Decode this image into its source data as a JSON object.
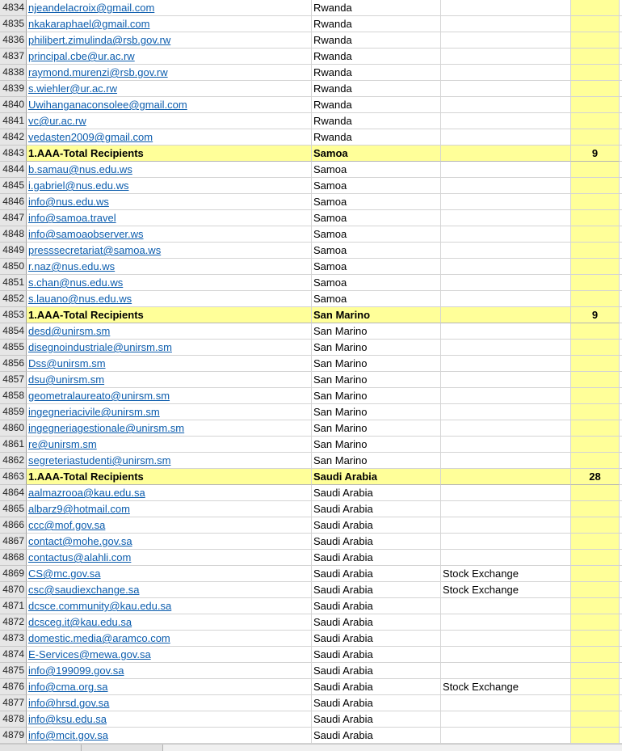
{
  "rows": [
    {
      "num": "4834",
      "email": "njeandelacroix@gmail.com",
      "country": "Rwanda",
      "category": "",
      "count": "",
      "total": false
    },
    {
      "num": "4835",
      "email": "nkakaraphael@gmail.com",
      "country": "Rwanda",
      "category": "",
      "count": "",
      "total": false
    },
    {
      "num": "4836",
      "email": "philibert.zimulinda@rsb.gov.rw",
      "country": "Rwanda",
      "category": "",
      "count": "",
      "total": false
    },
    {
      "num": "4837",
      "email": "principal.cbe@ur.ac.rw",
      "country": "Rwanda",
      "category": "",
      "count": "",
      "total": false
    },
    {
      "num": "4838",
      "email": "raymond.murenzi@rsb.gov.rw",
      "country": "Rwanda",
      "category": "",
      "count": "",
      "total": false
    },
    {
      "num": "4839",
      "email": "s.wiehler@ur.ac.rw",
      "country": "Rwanda",
      "category": "",
      "count": "",
      "total": false
    },
    {
      "num": "4840",
      "email": "Uwihanganaconsolee@gmail.com",
      "country": "Rwanda",
      "category": "",
      "count": "",
      "total": false
    },
    {
      "num": "4841",
      "email": "vc@ur.ac.rw",
      "country": "Rwanda",
      "category": "",
      "count": "",
      "total": false
    },
    {
      "num": "4842",
      "email": "vedasten2009@gmail.com",
      "country": "Rwanda",
      "category": "",
      "count": "",
      "total": false
    },
    {
      "num": "4843",
      "email": "1.AAA-Total Recipients",
      "country": "Samoa",
      "category": "",
      "count": "9",
      "total": true
    },
    {
      "num": "4844",
      "email": "b.samau@nus.edu.ws",
      "country": "Samoa",
      "category": "",
      "count": "",
      "total": false
    },
    {
      "num": "4845",
      "email": "i.gabriel@nus.edu.ws",
      "country": "Samoa",
      "category": "",
      "count": "",
      "total": false
    },
    {
      "num": "4846",
      "email": "info@nus.edu.ws",
      "country": "Samoa",
      "category": "",
      "count": "",
      "total": false
    },
    {
      "num": "4847",
      "email": "info@samoa.travel",
      "country": "Samoa",
      "category": "",
      "count": "",
      "total": false
    },
    {
      "num": "4848",
      "email": "info@samoaobserver.ws",
      "country": "Samoa",
      "category": "",
      "count": "",
      "total": false
    },
    {
      "num": "4849",
      "email": "presssecretariat@samoa.ws",
      "country": "Samoa",
      "category": "",
      "count": "",
      "total": false
    },
    {
      "num": "4850",
      "email": "r.naz@nus.edu.ws",
      "country": "Samoa",
      "category": "",
      "count": "",
      "total": false
    },
    {
      "num": "4851",
      "email": "s.chan@nus.edu.ws",
      "country": "Samoa",
      "category": "",
      "count": "",
      "total": false
    },
    {
      "num": "4852",
      "email": "s.lauano@nus.edu.ws",
      "country": "Samoa",
      "category": "",
      "count": "",
      "total": false
    },
    {
      "num": "4853",
      "email": "1.AAA-Total Recipients",
      "country": "San Marino",
      "category": "",
      "count": "9",
      "total": true
    },
    {
      "num": "4854",
      "email": "desd@unirsm.sm",
      "country": "San Marino",
      "category": "",
      "count": "",
      "total": false
    },
    {
      "num": "4855",
      "email": "disegnoindustriale@unirsm.sm",
      "country": "San Marino",
      "category": "",
      "count": "",
      "total": false
    },
    {
      "num": "4856",
      "email": "Dss@unirsm.sm",
      "country": "San Marino",
      "category": "",
      "count": "",
      "total": false
    },
    {
      "num": "4857",
      "email": "dsu@unirsm.sm",
      "country": "San Marino",
      "category": "",
      "count": "",
      "total": false
    },
    {
      "num": "4858",
      "email": "geometralaureato@unirsm.sm",
      "country": "San Marino",
      "category": "",
      "count": "",
      "total": false
    },
    {
      "num": "4859",
      "email": "ingegneriacivile@unirsm.sm",
      "country": "San Marino",
      "category": "",
      "count": "",
      "total": false
    },
    {
      "num": "4860",
      "email": "ingegneriagestionale@unirsm.sm",
      "country": "San Marino",
      "category": "",
      "count": "",
      "total": false
    },
    {
      "num": "4861",
      "email": "re@unirsm.sm",
      "country": "San Marino",
      "category": "",
      "count": "",
      "total": false
    },
    {
      "num": "4862",
      "email": "segreteriastudenti@unirsm.sm",
      "country": "San Marino",
      "category": "",
      "count": "",
      "total": false
    },
    {
      "num": "4863",
      "email": "1.AAA-Total Recipients",
      "country": "Saudi Arabia",
      "category": "",
      "count": "28",
      "total": true
    },
    {
      "num": "4864",
      "email": "aalmazrooa@kau.edu.sa",
      "country": "Saudi Arabia",
      "category": "",
      "count": "",
      "total": false
    },
    {
      "num": "4865",
      "email": "albarz9@hotmail.com",
      "country": "Saudi Arabia",
      "category": "",
      "count": "",
      "total": false
    },
    {
      "num": "4866",
      "email": "ccc@mof.gov.sa",
      "country": "Saudi Arabia",
      "category": "",
      "count": "",
      "total": false
    },
    {
      "num": "4867",
      "email": "contact@mohe.gov.sa",
      "country": "Saudi Arabia",
      "category": "",
      "count": "",
      "total": false
    },
    {
      "num": "4868",
      "email": "contactus@alahli.com",
      "country": "Saudi Arabia",
      "category": "",
      "count": "",
      "total": false
    },
    {
      "num": "4869",
      "email": "CS@mc.gov.sa",
      "country": "Saudi Arabia",
      "category": "Stock Exchange",
      "count": "",
      "total": false
    },
    {
      "num": "4870",
      "email": "csc@saudiexchange.sa",
      "country": "Saudi Arabia",
      "category": "Stock Exchange",
      "count": "",
      "total": false
    },
    {
      "num": "4871",
      "email": "dcsce.community@kau.edu.sa",
      "country": "Saudi Arabia",
      "category": "",
      "count": "",
      "total": false
    },
    {
      "num": "4872",
      "email": "dcsceg.it@kau.edu.sa",
      "country": "Saudi Arabia",
      "category": "",
      "count": "",
      "total": false
    },
    {
      "num": "4873",
      "email": "domestic.media@aramco.com",
      "country": "Saudi Arabia",
      "category": "",
      "count": "",
      "total": false
    },
    {
      "num": "4874",
      "email": "E-Services@mewa.gov.sa",
      "country": "Saudi Arabia",
      "category": "",
      "count": "",
      "total": false
    },
    {
      "num": "4875",
      "email": "info@199099.gov.sa",
      "country": "Saudi Arabia",
      "category": "",
      "count": "",
      "total": false
    },
    {
      "num": "4876",
      "email": "info@cma.org.sa",
      "country": "Saudi Arabia",
      "category": "Stock Exchange",
      "count": "",
      "total": false
    },
    {
      "num": "4877",
      "email": "info@hrsd.gov.sa",
      "country": "Saudi Arabia",
      "category": "",
      "count": "",
      "total": false
    },
    {
      "num": "4878",
      "email": "info@ksu.edu.sa",
      "country": "Saudi Arabia",
      "category": "",
      "count": "",
      "total": false
    },
    {
      "num": "4879",
      "email": "info@mcit.gov.sa",
      "country": "Saudi Arabia",
      "category": "",
      "count": "",
      "total": false
    }
  ]
}
